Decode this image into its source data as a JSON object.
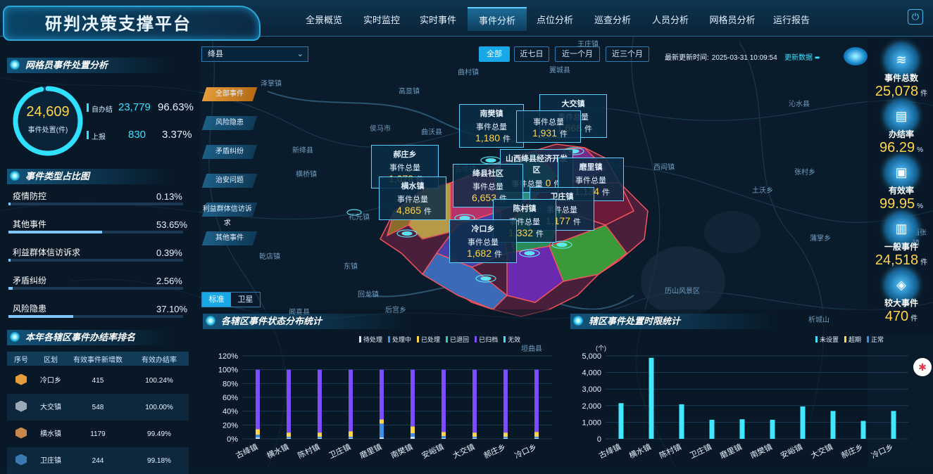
{
  "app": {
    "title": "研判决策支撑平台"
  },
  "nav": {
    "items": [
      "全景概览",
      "实时监控",
      "实时事件",
      "事件分析",
      "点位分析",
      "巡查分析",
      "人员分析",
      "网格员分析",
      "运行报告"
    ],
    "active": "事件分析"
  },
  "colors": {
    "accent": "#18a8e8",
    "highlight": "#ffd54a",
    "cyan": "#3fe0ff",
    "active_cat": "#e59c3a"
  },
  "grid_handling": {
    "title": "网格员事件处置分析",
    "total": "24,609",
    "total_label": "事件处置(件)",
    "self_label": "自办结",
    "self_value": "23,779",
    "self_pct": "96.63%",
    "self_ratio": 0.9663,
    "report_label": "上报",
    "report_value": "830",
    "report_pct": "3.37%"
  },
  "event_types": {
    "title": "事件类型占比图",
    "items": [
      {
        "label": "疫情防控",
        "pct": "0.13%",
        "ratio": 0.0013
      },
      {
        "label": "其他事件",
        "pct": "53.65%",
        "ratio": 0.5365
      },
      {
        "label": "利益群体信访诉求",
        "pct": "0.39%",
        "ratio": 0.0039
      },
      {
        "label": "矛盾纠纷",
        "pct": "2.56%",
        "ratio": 0.0256
      },
      {
        "label": "风险隐患",
        "pct": "37.10%",
        "ratio": 0.371
      }
    ]
  },
  "ranking": {
    "title": "本年各辖区事件办结率排名",
    "headers": [
      "序号",
      "区划",
      "有效事件新增数",
      "有效办结率"
    ],
    "rows": [
      {
        "area": "冷口乡",
        "count": "415",
        "rate": "100.24%"
      },
      {
        "area": "大交镇",
        "count": "548",
        "rate": "100.00%"
      },
      {
        "area": "横水镇",
        "count": "1179",
        "rate": "99.49%"
      },
      {
        "area": "卫庄镇",
        "count": "244",
        "rate": "99.18%"
      }
    ]
  },
  "map": {
    "county_select": "绛县",
    "time_filters": [
      "全部",
      "近七日",
      "近一个月",
      "近三个月"
    ],
    "active_filter": "全部",
    "update_label": "最新更新时间:",
    "update_time": "2025-03-31 10:09:54",
    "refresh_label": "更新数据",
    "categories": [
      "全部事件",
      "风险隐患",
      "矛盾纠纷",
      "治安问题",
      "利益群体信访诉求",
      "其他事件"
    ],
    "active_category": "全部事件",
    "view_toggle": [
      "标准",
      "卫星"
    ],
    "count_label": "事件总量",
    "unit": "件",
    "popups": [
      {
        "name": "南樊镇",
        "value": "1,180"
      },
      {
        "name": "大交镇",
        "value": "1,668"
      },
      {
        "name": "",
        "value": "1,931"
      },
      {
        "name": "郝庄乡",
        "value": "1,078"
      },
      {
        "name": "山西绛县经济开发区",
        "value": "0"
      },
      {
        "name": "磨里镇",
        "value": "1,134"
      },
      {
        "name": "绛县社区",
        "value": "6,653"
      },
      {
        "name": "横水镇",
        "value": "4,865"
      },
      {
        "name": "卫庄镇",
        "value": "1,177"
      },
      {
        "name": "陈村镇",
        "value": "1,332"
      },
      {
        "name": "冷口乡",
        "value": "1,682"
      }
    ],
    "place_labels": [
      "曲村镇",
      "翼城县",
      "高显镇",
      "泽掌镇",
      "曲沃县",
      "侯马市",
      "新绛县",
      "横桥镇",
      "礼元镇",
      "东镇",
      "乾店镇",
      "闻喜县",
      "后宫乡",
      "回龙镇",
      "郝庄乡",
      "古绛镇",
      "沁水县",
      "西阎镇",
      "张村乡",
      "土沃乡",
      "历山风景区",
      "析城山",
      "垣曲县",
      "蒲掌乡",
      "王庄镇",
      "西张镇"
    ]
  },
  "right_stats": [
    {
      "label": "事件总数",
      "value": "25,078",
      "unit": "件",
      "icon": "layers-icon"
    },
    {
      "label": "办结率",
      "value": "96.29",
      "unit": "%",
      "icon": "document-icon"
    },
    {
      "label": "有效率",
      "value": "99.95",
      "unit": "%",
      "icon": "document-check-icon"
    },
    {
      "label": "一般事件",
      "value": "24,518",
      "unit": "件",
      "icon": "clipboard-icon"
    },
    {
      "label": "较大事件",
      "value": "470",
      "unit": "件",
      "icon": "alert-icon"
    }
  ],
  "chart_status": {
    "title": "各辖区事件状态分布统计",
    "legend": [
      "待处理",
      "处理中",
      "已处理",
      "已退回",
      "已归档",
      "无效"
    ],
    "legend_colors": [
      "#cfe6ff",
      "#3a8fe8",
      "#ffd54a",
      "#2ecfa8",
      "#7b4dff",
      "#3fe0ff"
    ],
    "yticks": [
      "0%",
      "20%",
      "40%",
      "60%",
      "80%",
      "100%",
      "120%"
    ]
  },
  "chart_time": {
    "title": "辖区事件处置时限统计",
    "legend": [
      "未设置",
      "超期",
      "正常"
    ],
    "legend_colors": [
      "#3fe0ff",
      "#ffd54a",
      "#3a8fe8"
    ],
    "yunit": "(个)",
    "yticks": [
      "0",
      "1,000",
      "2,000",
      "3,000",
      "4,000",
      "5,000"
    ]
  },
  "chart_data": [
    {
      "type": "bar",
      "title": "各辖区事件状态分布统计",
      "categories": [
        "古绛镇",
        "横水镇",
        "陈村镇",
        "卫庄镇",
        "磨里镇",
        "南樊镇",
        "安峪镇",
        "大交镇",
        "郝庄乡",
        "冷口乡"
      ],
      "ylim": [
        0,
        120
      ],
      "series": [
        {
          "name": "待处理",
          "values": [
            2,
            1,
            1,
            1,
            2,
            3,
            1,
            1,
            1,
            1
          ]
        },
        {
          "name": "处理中",
          "values": [
            4,
            2,
            2,
            2,
            20,
            5,
            3,
            2,
            2,
            2
          ]
        },
        {
          "name": "已处理",
          "values": [
            8,
            6,
            6,
            8,
            6,
            10,
            6,
            6,
            6,
            7
          ]
        },
        {
          "name": "已归档",
          "values": [
            86,
            91,
            91,
            89,
            72,
            82,
            90,
            91,
            91,
            90
          ]
        }
      ]
    },
    {
      "type": "bar",
      "title": "辖区事件处置时限统计",
      "categories": [
        "古绛镇",
        "横水镇",
        "陈村镇",
        "卫庄镇",
        "磨里镇",
        "南樊镇",
        "安峪镇",
        "大交镇",
        "郝庄乡",
        "冷口乡"
      ],
      "ylim": [
        0,
        5000
      ],
      "series": [
        {
          "name": "未设置",
          "values": [
            2150,
            4880,
            2080,
            1150,
            1180,
            1150,
            1950,
            1680,
            1080,
            1680
          ]
        }
      ]
    }
  ]
}
